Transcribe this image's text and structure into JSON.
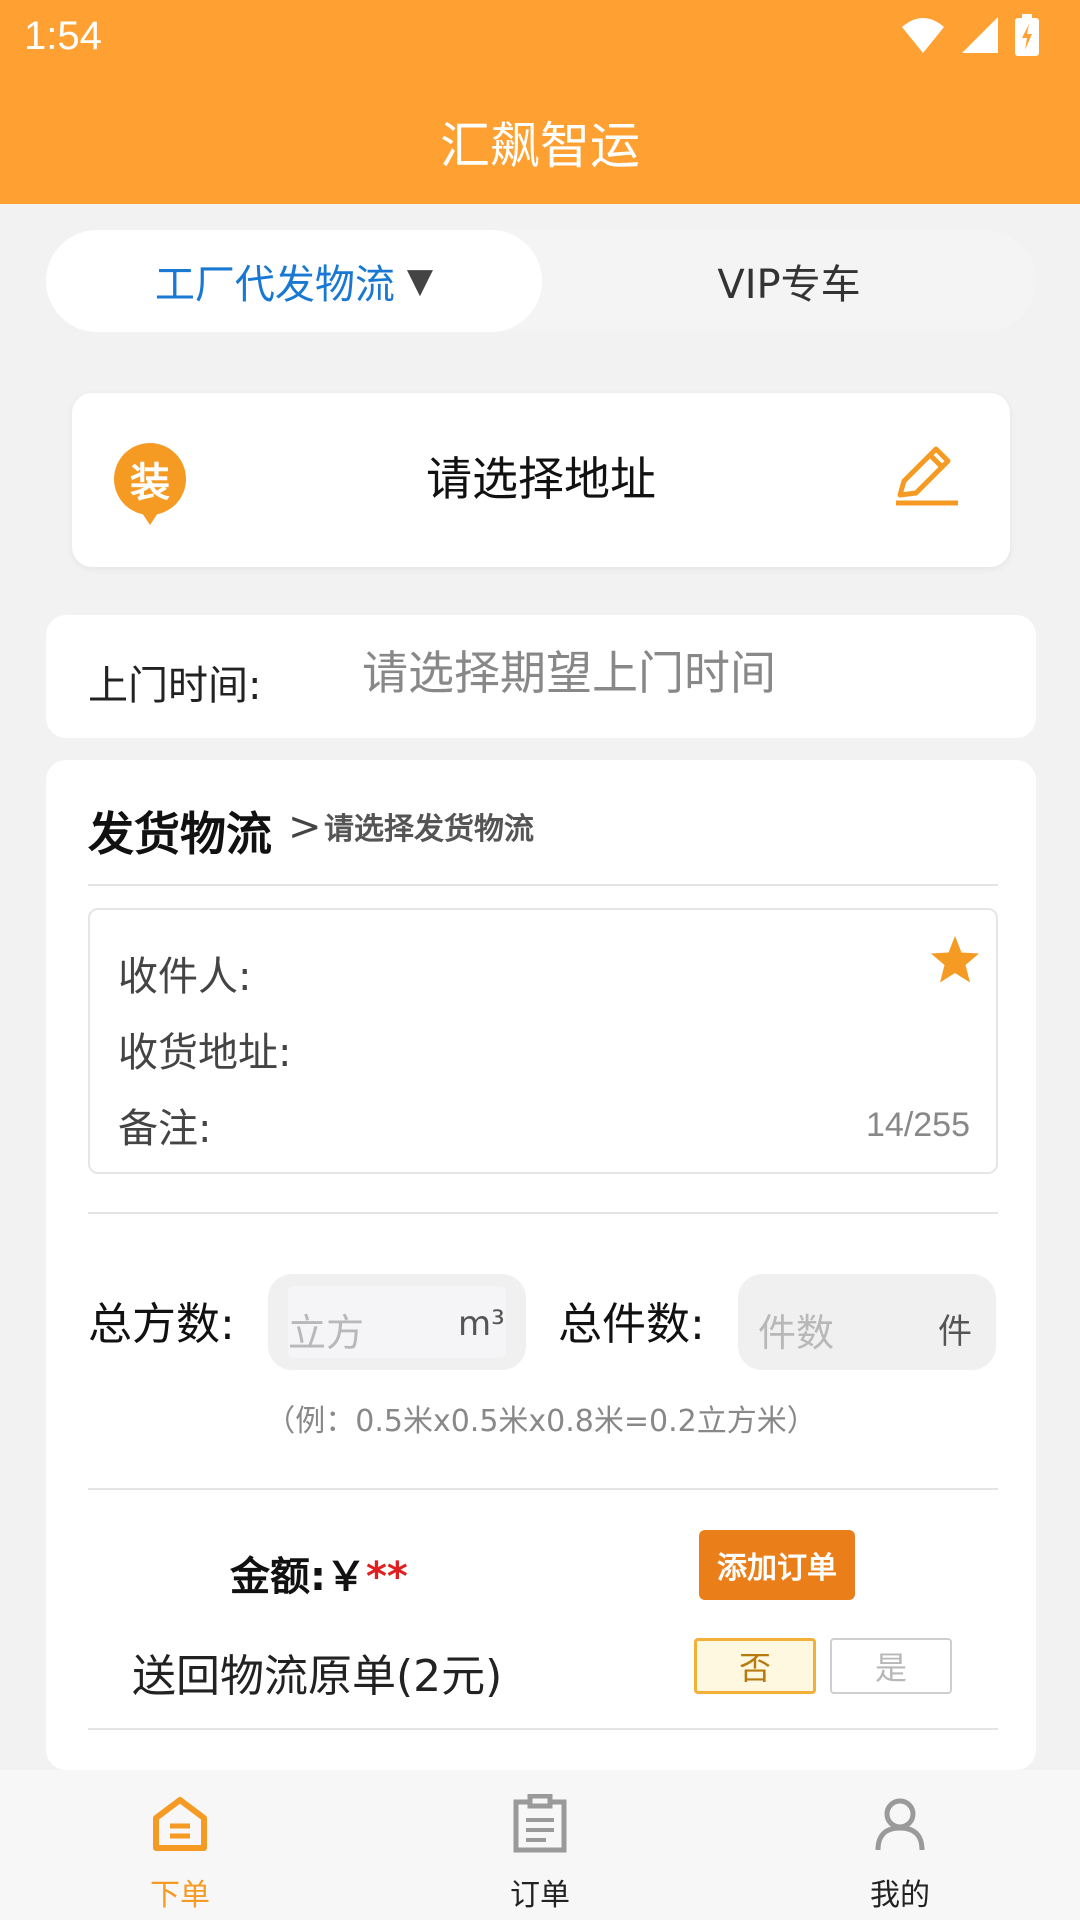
{
  "status_bar": {
    "time": "1:54"
  },
  "app_bar": {
    "title": "汇飙智运"
  },
  "tabs": [
    {
      "label": "工厂代发物流",
      "arrow": "▼",
      "active": true
    },
    {
      "label": "VIP专车",
      "active": false
    }
  ],
  "address_card": {
    "badge": "装",
    "text": "请选择地址",
    "icon": "edit-pencil-icon"
  },
  "pickup_time": {
    "label": "上门时间:",
    "value": "请选择期望上门时间"
  },
  "logistics": {
    "title": "发货物流",
    "chevron": ">",
    "hint": "请选择发货物流",
    "recipient_label": "收件人:",
    "address_label": "收货地址:",
    "remark_label": "备注:",
    "counter": "14/255"
  },
  "quantity": {
    "volume_label": "总方数:",
    "volume_placeholder": "立方",
    "volume_unit": "m³",
    "pieces_label": "总件数:",
    "pieces_placeholder": "件数",
    "pieces_unit": "件",
    "example": "（例：0.5米x0.5米x0.8米=0.2立方米）"
  },
  "amount": {
    "label": "金额:￥",
    "value": "**"
  },
  "add_order_label": "添加订单",
  "return_receipt": {
    "label": "送回物流原单(2元)",
    "no": "否",
    "yes": "是",
    "selected": "否"
  },
  "bottom_nav": [
    {
      "label": "下单",
      "icon": "home-icon",
      "active": true
    },
    {
      "label": "订单",
      "icon": "clipboard-icon",
      "active": false
    },
    {
      "label": "我的",
      "icon": "person-icon",
      "active": false
    }
  ],
  "colors": {
    "primary": "#fea132",
    "accent": "#f59a23",
    "link": "#1978d2",
    "button": "#ea7f1a",
    "price_red": "#e02020"
  }
}
